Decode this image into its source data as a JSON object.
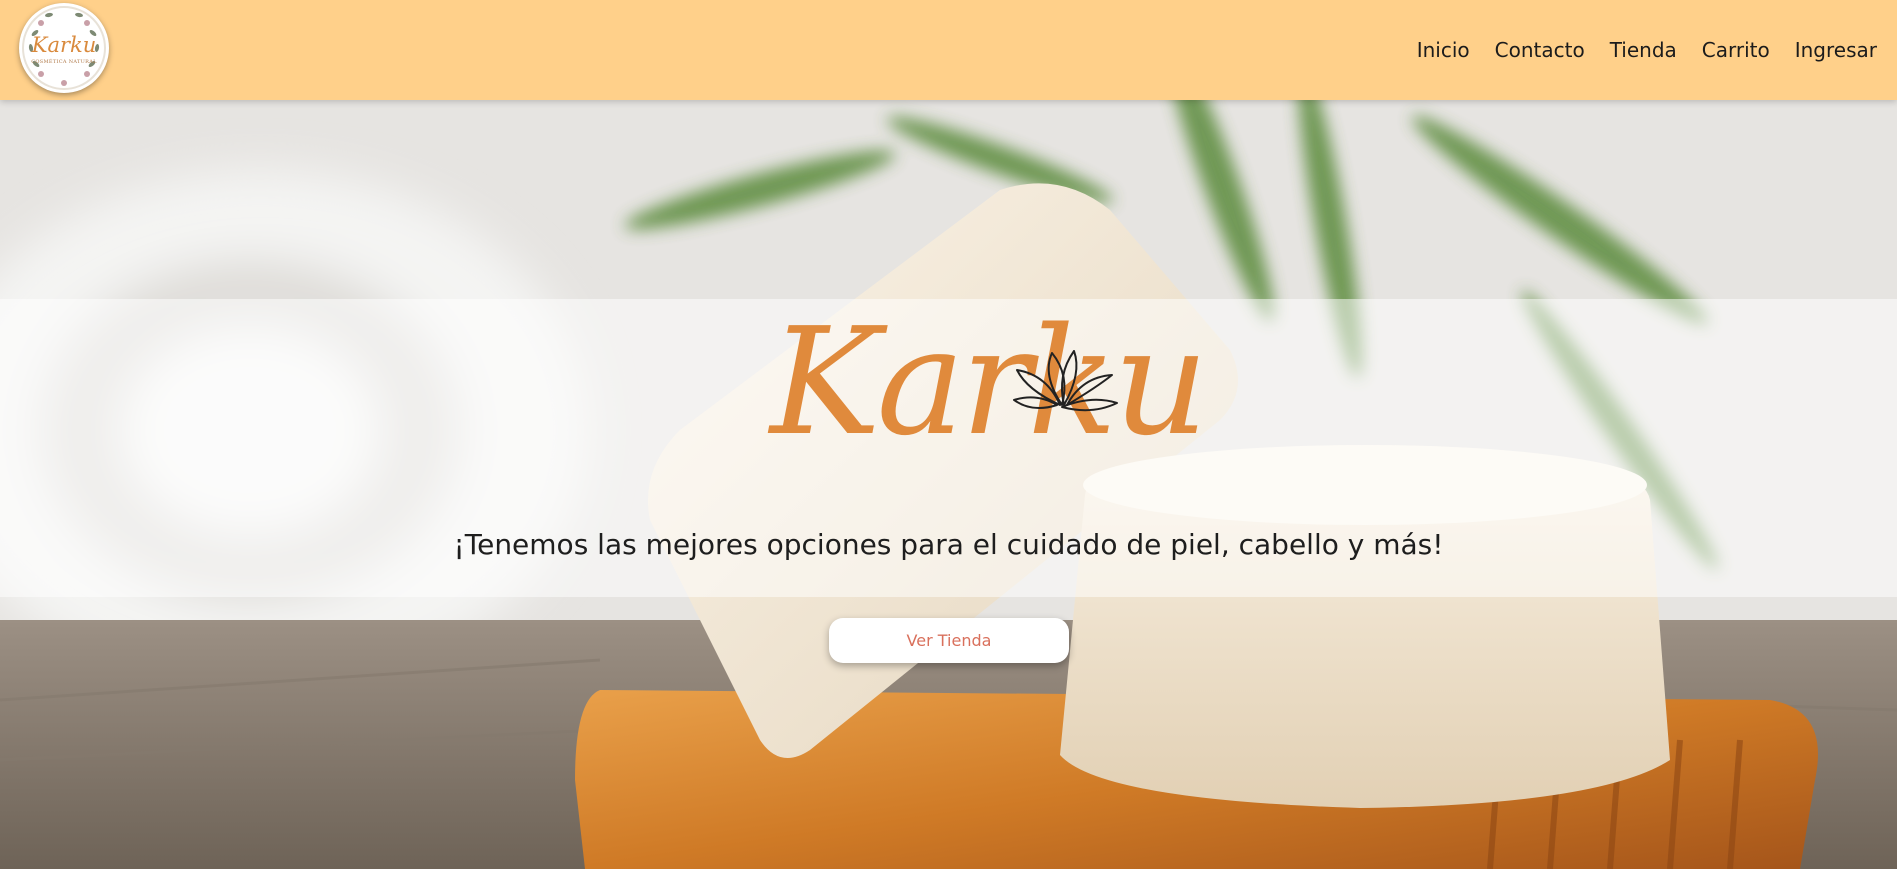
{
  "header": {
    "logo": {
      "name": "Karku",
      "subtitle": "COSMÉTICA NATURAL"
    },
    "nav": [
      {
        "label": "Inicio"
      },
      {
        "label": "Contacto"
      },
      {
        "label": "Tienda"
      },
      {
        "label": "Carrito"
      },
      {
        "label": "Ingresar"
      }
    ]
  },
  "hero": {
    "wordmark": "Karku",
    "wordmark_icon": "lotus-flower-icon",
    "tagline": "¡Tenemos las mejores opciones para el cuidado de piel, cabello y más!",
    "cta_label": "Ver Tienda"
  },
  "colors": {
    "header_bg": "#ffd08a",
    "wordmark": "#e08a3c",
    "cta_text": "#d9705c",
    "band_overlay": "rgba(255,255,255,0.52)"
  }
}
